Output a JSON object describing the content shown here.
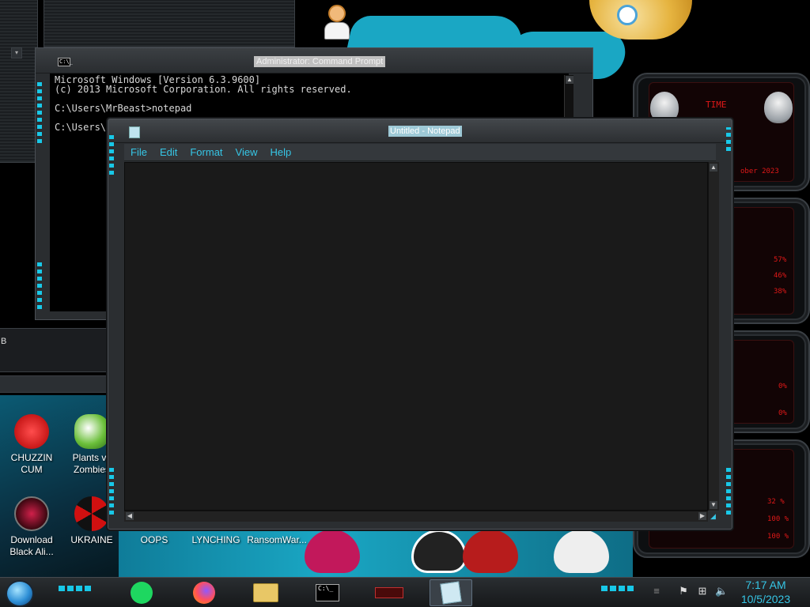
{
  "desktop": {
    "icons": [
      {
        "label_line1": "CHUZZIN",
        "label_line2": "CUM"
      },
      {
        "label_line1": "Plants vs",
        "label_line2": "Zombies"
      },
      {
        "label_line1": "Download",
        "label_line2": "Black Ali..."
      },
      {
        "label_line1": "UKRAINE",
        "label_line2": ""
      },
      {
        "label_line1": "OOPS",
        "label_line2": ""
      },
      {
        "label_line1": "LYNCHING",
        "label_line2": ""
      },
      {
        "label_line1": "RansomWar...",
        "label_line2": ""
      }
    ],
    "left_window_letter": "B"
  },
  "gadgets": {
    "time_label": "TIME",
    "date_partial": "ober 2023",
    "cpu_values": [
      "57%",
      "46%",
      "38%"
    ],
    "mem_values": [
      "0%",
      "0%"
    ],
    "net_values": [
      "32 %",
      "100 %",
      "100 %"
    ]
  },
  "cmd": {
    "title": "Administrator: Command Prompt",
    "icon_text": "C:\\_",
    "lines": [
      "Microsoft Windows [Version 6.3.9600]",
      "(c) 2013 Microsoft Corporation. All rights reserved.",
      "",
      "C:\\Users\\MrBeast>notepad",
      "",
      "C:\\Users\\"
    ]
  },
  "notepad": {
    "title": "Untitled - Notepad",
    "menu": [
      "File",
      "Edit",
      "Format",
      "View",
      "Help"
    ],
    "content": ""
  },
  "taskbar": {
    "pinned": [
      "spotify",
      "firefox",
      "file-explorer",
      "command-prompt",
      "app",
      "notepad"
    ],
    "active": "notepad",
    "clock": {
      "time": "7:17 AM",
      "date": "10/5/2023"
    },
    "colors": {
      "accent": "#36c6e6",
      "gadget_red": "#e01818"
    }
  }
}
